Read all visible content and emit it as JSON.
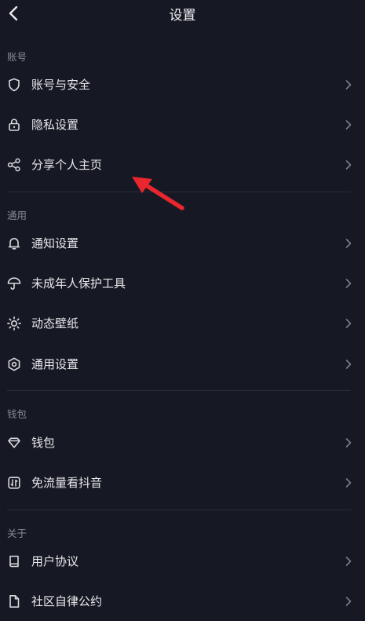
{
  "header": {
    "title": "设置"
  },
  "sections": {
    "account": {
      "label": "账号",
      "items": [
        "账号与安全",
        "隐私设置",
        "分享个人主页"
      ]
    },
    "general": {
      "label": "通用",
      "items": [
        "通知设置",
        "未成年人保护工具",
        "动态壁纸",
        "通用设置"
      ]
    },
    "wallet": {
      "label": "钱包",
      "items": [
        "钱包",
        "免流量看抖音"
      ]
    },
    "about": {
      "label": "关于",
      "items": [
        "用户协议",
        "社区自律公约"
      ]
    }
  },
  "colors": {
    "background": "#161823",
    "annotation_arrow": "#e8262d"
  },
  "icons": {
    "account_security": "shield-icon",
    "privacy": "lock-icon",
    "share": "share-icon",
    "notification": "bell-icon",
    "minor_protection": "umbrella-icon",
    "live_wallpaper": "gear-sun-icon",
    "general_settings": "hexagon-icon",
    "wallet": "diamond-icon",
    "free_data": "data-icon",
    "user_agreement": "book-icon",
    "community_guidelines": "document-icon"
  }
}
